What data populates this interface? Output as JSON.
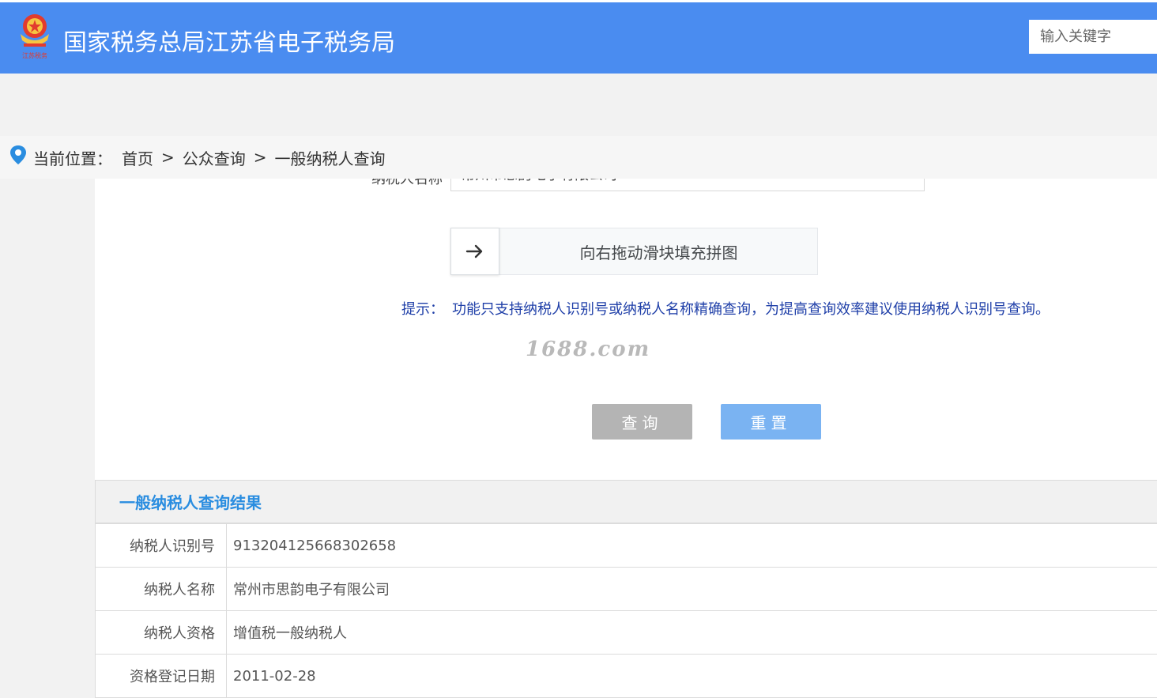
{
  "header": {
    "logo_text": "江苏税务",
    "title": "国家税务总局江苏省电子税务局",
    "search_placeholder": "输入关键字"
  },
  "breadcrumb": {
    "label": "当前位置：",
    "items": [
      "首页",
      "公众查询",
      "一般纳税人查询"
    ],
    "separator": ">"
  },
  "form": {
    "taxpayer_name_label": "纳税人名称",
    "taxpayer_name_value": "常州市思韵电子有限公司",
    "slider_text": "向右拖动滑块填充拼图",
    "hint_label": "提示：",
    "hint_text": "功能只支持纳税人识别号或纳税人名称精确查询，为提高查询效率建议使用纳税人识别号查询。",
    "watermark": "1688.com",
    "query_button": "查询",
    "reset_button": "重置"
  },
  "result": {
    "title": "一般纳税人查询结果",
    "rows": [
      {
        "label": "纳税人识别号",
        "value": "913204125668302658"
      },
      {
        "label": "纳税人名称",
        "value": "常州市思韵电子有限公司"
      },
      {
        "label": "纳税人资格",
        "value": "增值税一般纳税人"
      },
      {
        "label": "资格登记日期",
        "value": "2011-02-28"
      }
    ]
  },
  "colors": {
    "header_bg": "#4a8cf0",
    "hint_text": "#1f3fa8",
    "result_title": "#2a8de0",
    "query_button": "#b4b4b4",
    "reset_button": "#7ab3f2"
  }
}
